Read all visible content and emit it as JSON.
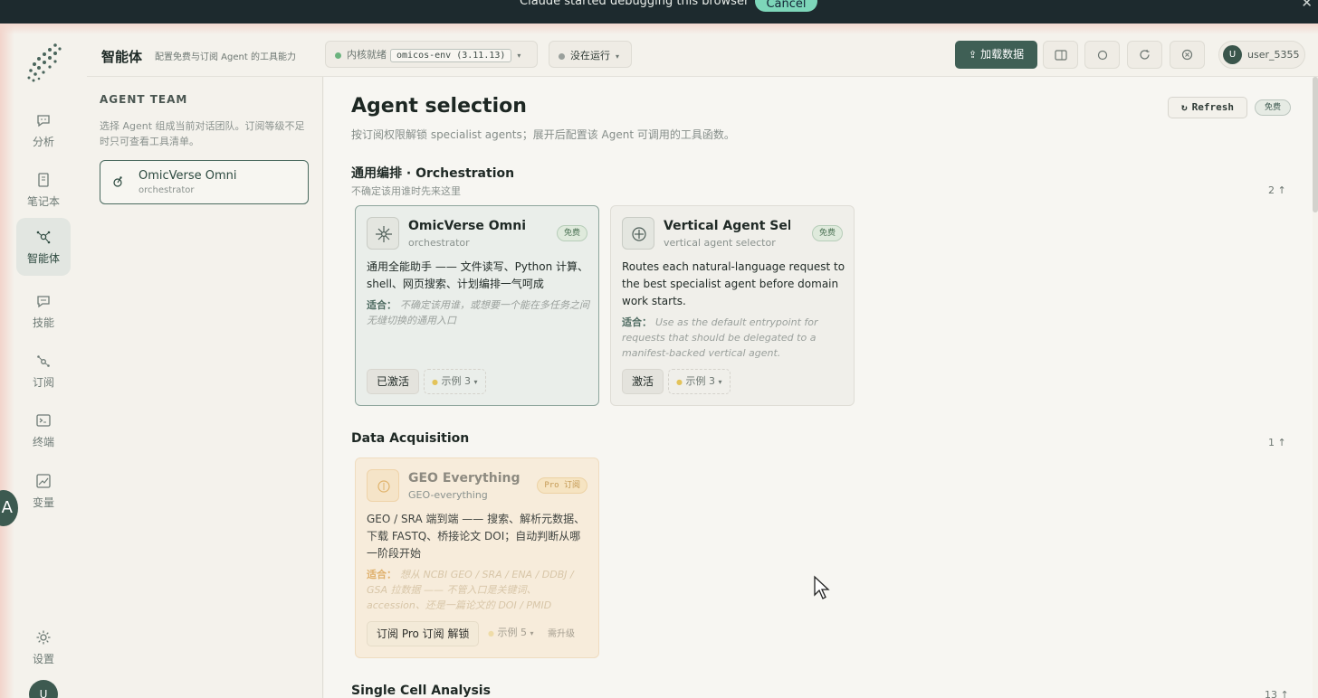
{
  "banner": {
    "text": "Claude  started debugging this browser",
    "cancel": "Cancel",
    "close": "✕"
  },
  "rail": {
    "items": [
      {
        "label": "分析",
        "icon": "chat-icon"
      },
      {
        "label": "笔记本",
        "icon": "notebook-icon"
      },
      {
        "label": "智能体",
        "icon": "agent-icon",
        "active": true
      },
      {
        "label": "技能",
        "icon": "skill-icon"
      },
      {
        "label": "订阅",
        "icon": "subscription-icon"
      },
      {
        "label": "终端",
        "icon": "terminal-icon"
      },
      {
        "label": "变量",
        "icon": "variables-icon"
      }
    ],
    "settings": "设置",
    "avatar": "U",
    "floating": "A"
  },
  "header": {
    "title": "智能体",
    "subtitle": "配置免费与订阅 Agent 的工具能力",
    "kernel_status": "内核就绪",
    "env": "omicos-env (3.11.13)",
    "run_status": "没在运行",
    "load_data": "加载数据",
    "user": "user_5355",
    "user_initial": "U"
  },
  "team": {
    "title": "AGENT TEAM",
    "desc": "选择 Agent 组成当前对话团队。订阅等级不足时只可查看工具清单。",
    "member": {
      "name": "OmicVerse Omni",
      "role": "orchestrator"
    }
  },
  "main": {
    "title": "Agent selection",
    "subtitle": "按订阅权限解锁 specialist agents；展开后配置该 Agent 可调用的工具函数。",
    "refresh": "Refresh",
    "tier": "免费",
    "sections": [
      {
        "title": "通用编排 · Orchestration",
        "subtitle": "不确定该用谁时先来这里",
        "count": "2",
        "cards": [
          {
            "name": "OmicVerse Omni",
            "sub": "orchestrator",
            "badge": "免费",
            "desc": "通用全能助手 —— 文件读写、Python 计算、shell、网页搜索、计划编排一气呵成",
            "fit_label": "适合：",
            "fit": "不确定该用谁，或想要一个能在多任务之间无缝切换的通用入口",
            "action": "已激活",
            "examples": "示例 3"
          },
          {
            "name": "Vertical Agent Sele…",
            "sub": "vertical agent selector",
            "badge": "免费",
            "desc": "Routes each natural-language request to the best specialist agent before domain work starts.",
            "fit_label": "适合：",
            "fit": "Use as the default entrypoint for requests that should be delegated to a manifest-backed vertical agent.",
            "action": "激活",
            "examples": "示例 3"
          }
        ]
      },
      {
        "title": "Data Acquisition",
        "count": "1",
        "cards": [
          {
            "name": "GEO Everything",
            "sub": "GEO-everything",
            "badge": "Pro 订阅",
            "desc": "GEO / SRA 端到端 —— 搜索、解析元数据、下载 FASTQ、桥接论文 DOI；自动判断从哪一阶段开始",
            "fit_label": "适合：",
            "fit": "想从 NCBI GEO / SRA / ENA / DDBJ / GSA 拉数据 —— 不管入口是关键词、accession、还是一篇论文的 DOI / PMID",
            "action": "订阅 Pro 订阅 解锁",
            "examples": "示例 5",
            "need": "需升级"
          }
        ]
      },
      {
        "title": "Single Cell Analysis",
        "count": "13"
      }
    ]
  }
}
